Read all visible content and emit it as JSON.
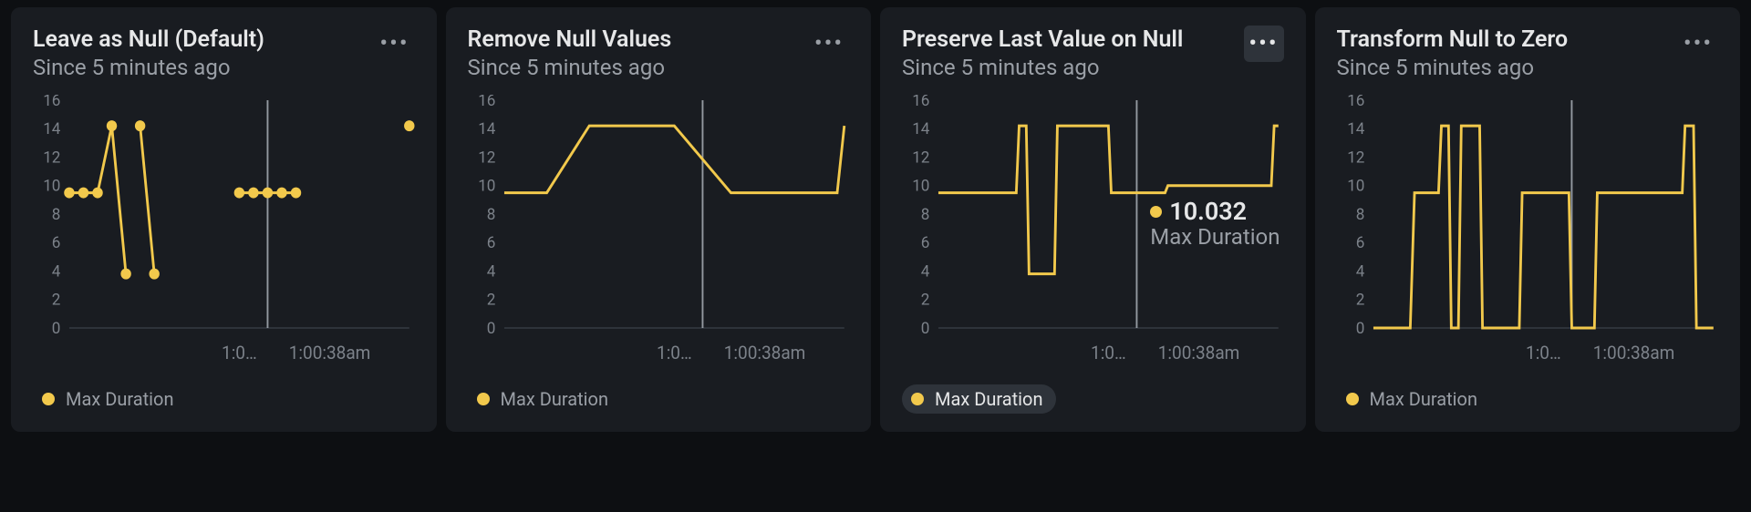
{
  "common": {
    "subtitle": "Since 5 minutes ago",
    "series_name": "Max Duration",
    "x_tick_1": "1:0…",
    "x_tick_2": "1:00:38am",
    "y_ticks": [
      0,
      2,
      4,
      6,
      8,
      10,
      12,
      14,
      16
    ]
  },
  "panels": [
    {
      "id": "leave-null",
      "title": "Leave as Null (Default)"
    },
    {
      "id": "remove-null",
      "title": "Remove Null Values"
    },
    {
      "id": "preserve-last",
      "title": "Preserve Last Value on Null"
    },
    {
      "id": "transform-zero",
      "title": "Transform Null to Zero"
    }
  ],
  "tooltip": {
    "panel": "preserve-last",
    "value": "10.032",
    "label": "Max Duration"
  },
  "chart_data": [
    {
      "type": "line",
      "panel": "leave-null",
      "title": "Leave as Null (Default)",
      "ylabel": "",
      "xlabel": "",
      "ylim": [
        0,
        16
      ],
      "series": [
        {
          "name": "Max Duration",
          "segments": [
            [
              [
                0,
                9.5
              ],
              [
                1,
                9.5
              ],
              [
                2,
                9.5
              ],
              [
                3,
                14.2
              ],
              [
                4,
                3.8
              ]
            ],
            [
              [
                5,
                14.2
              ],
              [
                6,
                3.8
              ]
            ],
            [
              [
                12,
                9.5
              ],
              [
                13,
                9.5
              ],
              [
                14,
                9.5
              ],
              [
                15,
                9.5
              ],
              [
                16,
                9.5
              ]
            ],
            [
              [
                24,
                14.2
              ]
            ]
          ]
        }
      ]
    },
    {
      "type": "line",
      "panel": "remove-null",
      "title": "Remove Null Values",
      "ylabel": "",
      "xlabel": "",
      "ylim": [
        0,
        16
      ],
      "series": [
        {
          "name": "Max Duration",
          "points": [
            [
              0,
              9.5
            ],
            [
              3,
              9.5
            ],
            [
              6,
              14.2
            ],
            [
              12,
              14.2
            ],
            [
              16,
              9.5
            ],
            [
              22,
              9.5
            ],
            [
              23.5,
              9.5
            ],
            [
              24,
              14.2
            ]
          ]
        }
      ]
    },
    {
      "type": "line",
      "panel": "preserve-last",
      "title": "Preserve Last Value on Null",
      "ylabel": "",
      "xlabel": "",
      "ylim": [
        0,
        16
      ],
      "series": [
        {
          "name": "Max Duration",
          "points": [
            [
              0,
              9.5
            ],
            [
              5.5,
              9.5
            ],
            [
              5.7,
              14.2
            ],
            [
              6.2,
              14.2
            ],
            [
              6.4,
              3.8
            ],
            [
              8.2,
              3.8
            ],
            [
              8.4,
              14.2
            ],
            [
              12,
              14.2
            ],
            [
              12.2,
              9.5
            ],
            [
              16,
              9.5
            ],
            [
              16.2,
              10.0
            ],
            [
              23.5,
              10.0
            ],
            [
              23.7,
              14.2
            ],
            [
              24,
              14.2
            ]
          ]
        }
      ]
    },
    {
      "type": "line",
      "panel": "transform-zero",
      "title": "Transform Null to Zero",
      "ylabel": "",
      "xlabel": "",
      "ylim": [
        0,
        16
      ],
      "series": [
        {
          "name": "Max Duration",
          "points": [
            [
              0,
              0
            ],
            [
              2.6,
              0
            ],
            [
              2.9,
              9.5
            ],
            [
              4.6,
              9.5
            ],
            [
              4.8,
              14.2
            ],
            [
              5.3,
              14.2
            ],
            [
              5.5,
              0
            ],
            [
              6.0,
              0
            ],
            [
              6.2,
              14.2
            ],
            [
              7.5,
              14.2
            ],
            [
              7.7,
              0
            ],
            [
              10.3,
              0
            ],
            [
              10.5,
              9.5
            ],
            [
              13.8,
              9.5
            ],
            [
              14,
              0
            ],
            [
              15.6,
              0
            ],
            [
              15.8,
              9.5
            ],
            [
              21.8,
              9.5
            ],
            [
              22,
              14.2
            ],
            [
              22.6,
              14.2
            ],
            [
              22.8,
              0
            ],
            [
              24,
              0
            ]
          ]
        }
      ]
    }
  ]
}
